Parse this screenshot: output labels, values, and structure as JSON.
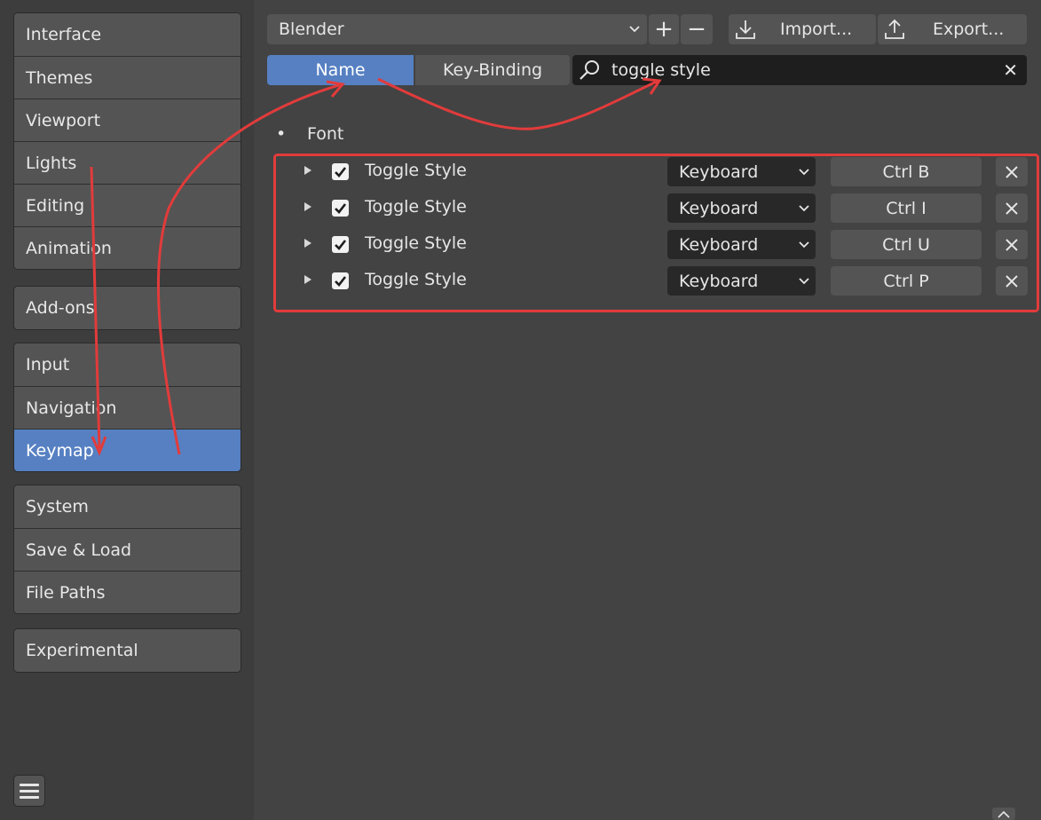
{
  "sidebar": {
    "group1": [
      {
        "label": "Interface"
      },
      {
        "label": "Themes"
      },
      {
        "label": "Viewport"
      },
      {
        "label": "Lights"
      },
      {
        "label": "Editing"
      },
      {
        "label": "Animation"
      }
    ],
    "group2": [
      {
        "label": "Add-ons"
      }
    ],
    "group3": [
      {
        "label": "Input"
      },
      {
        "label": "Navigation"
      },
      {
        "label": "Keymap"
      }
    ],
    "group4": [
      {
        "label": "System"
      },
      {
        "label": "Save & Load"
      },
      {
        "label": "File Paths"
      }
    ],
    "group5": [
      {
        "label": "Experimental"
      }
    ],
    "active": "Keymap"
  },
  "header": {
    "preset": "Blender",
    "add_symbol": "+",
    "remove_symbol": "−",
    "import_label": "Import...",
    "export_label": "Export..."
  },
  "search": {
    "mode_name": "Name",
    "mode_keybinding": "Key-Binding",
    "active_mode": "Name",
    "query": "toggle style",
    "clear_symbol": "✕"
  },
  "category": {
    "bullet": "•",
    "name": "Font"
  },
  "entries": [
    {
      "name": "Toggle Style",
      "enabled": true,
      "type": "Keyboard",
      "key": "Ctrl B"
    },
    {
      "name": "Toggle Style",
      "enabled": true,
      "type": "Keyboard",
      "key": "Ctrl I"
    },
    {
      "name": "Toggle Style",
      "enabled": true,
      "type": "Keyboard",
      "key": "Ctrl U"
    },
    {
      "name": "Toggle Style",
      "enabled": true,
      "type": "Keyboard",
      "key": "Ctrl P"
    }
  ],
  "colors": {
    "accent": "#5680c2",
    "annotation": "#e23b3b"
  }
}
